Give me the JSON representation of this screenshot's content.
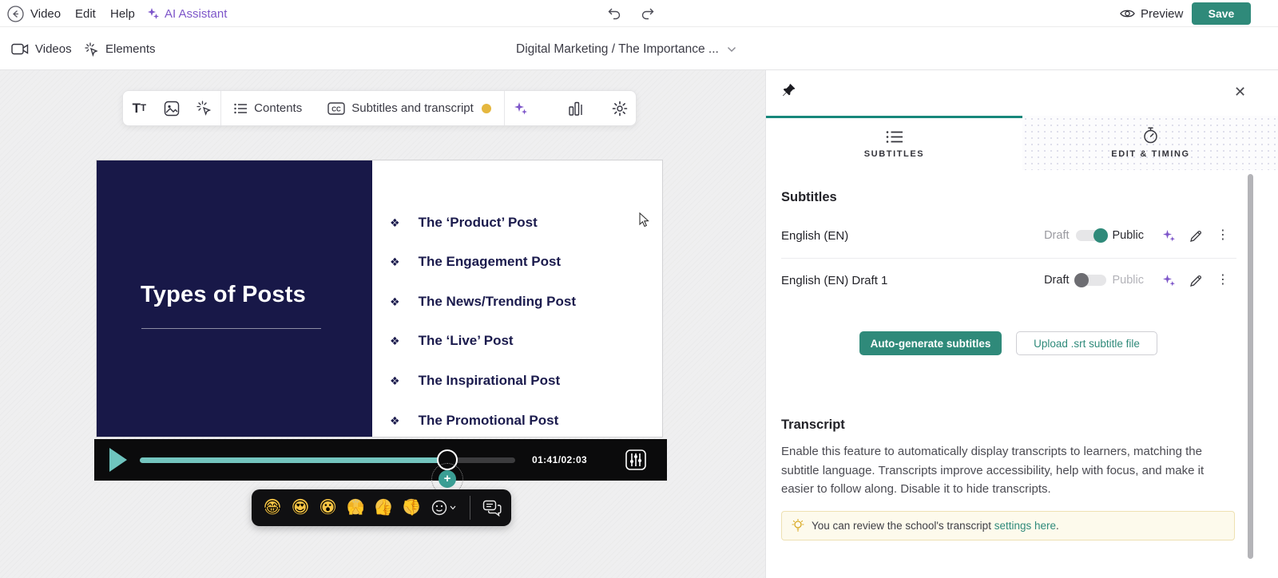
{
  "colors": {
    "accent_teal": "#2f8a7a",
    "accent_purple": "#7d55c9",
    "status_yellow": "#e5b73e",
    "slide_navy": "#181848"
  },
  "topbar": {
    "menu": {
      "video": "Video",
      "edit": "Edit",
      "help": "Help"
    },
    "ai_assistant": "AI Assistant",
    "preview": "Preview",
    "save": "Save"
  },
  "toolbar2": {
    "videos": "Videos",
    "elements": "Elements",
    "breadcrumb": "Digital Marketing / The Importance ..."
  },
  "float_toolbar": {
    "contents": "Contents",
    "subtitles": "Subtitles and transcript"
  },
  "slide": {
    "title": "Types of Posts",
    "bullet": "❖",
    "items": [
      "The ‘Product’ Post",
      "The Engagement Post",
      "The News/Trending Post",
      "The ‘Live’ Post",
      "The Inspirational Post",
      "The Promotional Post"
    ]
  },
  "player": {
    "current_time": "01:41",
    "separator": " / ",
    "total_time": "02:03",
    "progress_percent": 82,
    "plus": "+"
  },
  "reactions": {
    "emojis": [
      {
        "name": "joy",
        "glyph": "😂"
      },
      {
        "name": "heart-eyes",
        "glyph": "😍"
      },
      {
        "name": "surprised",
        "glyph": "😮"
      },
      {
        "name": "raised-hands",
        "glyph": "🙌"
      },
      {
        "name": "thumbs-up",
        "glyph": "👍"
      },
      {
        "name": "thumbs-down",
        "glyph": "👎"
      }
    ]
  },
  "panel": {
    "tabs": [
      {
        "label": "SUBTITLES"
      },
      {
        "label": "EDIT & TIMING"
      }
    ],
    "subtitles_heading": "Subtitles",
    "rows": [
      {
        "name": "English (EN)",
        "draft_label": "Draft",
        "public_label": "Public",
        "state": "public"
      },
      {
        "name": "English (EN) Draft 1",
        "draft_label": "Draft",
        "public_label": "Public",
        "state": "draft"
      }
    ],
    "auto_generate_button": "Auto-generate subtitles",
    "upload_button": "Upload .srt subtitle file",
    "transcript_heading": "Transcript",
    "transcript_body": "Enable this feature to automatically display transcripts to learners, matching the subtitle language. Transcripts improve accessibility, help with focus, and make it easier to follow along. Disable it to hide transcripts.",
    "info_prefix": "You can review the school's transcript ",
    "info_link": "settings here",
    "info_suffix": ".",
    "close": "✕"
  }
}
